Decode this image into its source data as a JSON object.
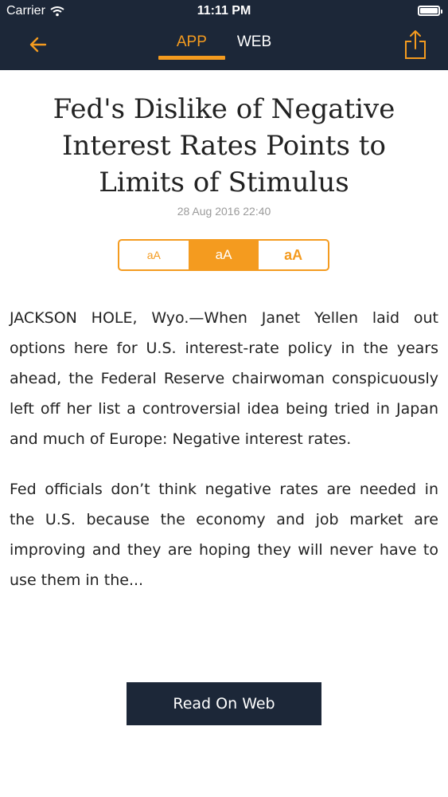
{
  "status_bar": {
    "carrier": "Carrier",
    "time": "11:11 PM"
  },
  "nav": {
    "tabs": [
      {
        "label": "APP",
        "active": true
      },
      {
        "label": "WEB",
        "active": false
      }
    ],
    "back_icon": "arrow-left-icon",
    "share_icon": "share-icon"
  },
  "article": {
    "title": "Fed's Dislike of Negative Interest Rates Points to Limits of Stimulus",
    "date": "28 Aug 2016 22:40",
    "paragraphs": [
      "JACKSON HOLE, Wyo.—When Janet Yellen laid out options here for U.S. interest-rate policy in the years ahead, the Federal Reserve chairwoman conspicuously left off her list a controversial idea being tried in Japan and much of Europe: Negative interest rates.",
      "Fed officials don’t think negative rates are needed in the U.S. because the economy and job market are improving and they are hoping they will never have to use them in the..."
    ]
  },
  "font_sizes": {
    "options": [
      "aA",
      "aA",
      "aA"
    ],
    "selected_index": 1
  },
  "read_on_web_label": "Read On Web",
  "colors": {
    "accent": "#f49b1f",
    "navbar": "#1c2738"
  }
}
